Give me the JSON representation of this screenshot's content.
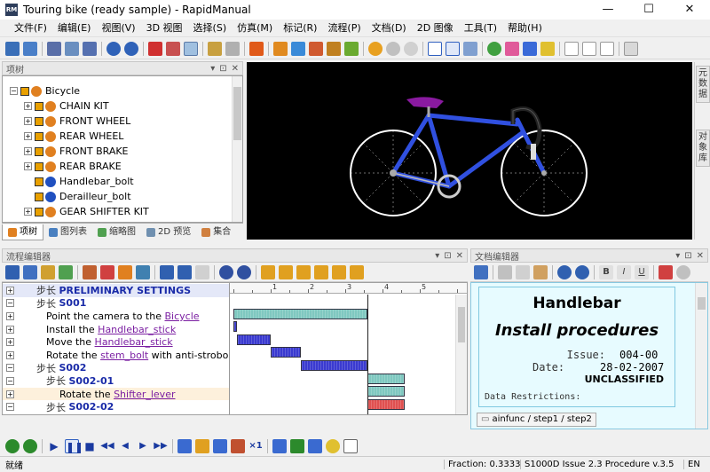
{
  "window": {
    "title": "Touring bike (ready sample) - RapidManual",
    "app_icon_text": "RM",
    "controls": [
      "—",
      "☐",
      "✕"
    ]
  },
  "menu": [
    "文件(F)",
    "编辑(E)",
    "视图(V)",
    "3D 视图",
    "选择(S)",
    "仿真(M)",
    "标记(R)",
    "流程(P)",
    "文档(D)",
    "2D 图像",
    "工具(T)",
    "帮助(H)"
  ],
  "project_panel": {
    "title": "项树",
    "tree": [
      {
        "label": "Bicycle",
        "level": 0,
        "expand": "−",
        "icon": "assembly"
      },
      {
        "label": "CHAIN KIT",
        "level": 1,
        "expand": "+",
        "icon": "assembly"
      },
      {
        "label": "FRONT WHEEL",
        "level": 1,
        "expand": "+",
        "icon": "assembly"
      },
      {
        "label": "REAR WHEEL",
        "level": 1,
        "expand": "+",
        "icon": "assembly"
      },
      {
        "label": "FRONT BRAKE",
        "level": 1,
        "expand": "+",
        "icon": "assembly"
      },
      {
        "label": "REAR BRAKE",
        "level": 1,
        "expand": "+",
        "icon": "assembly"
      },
      {
        "label": "Handlebar_bolt",
        "level": 1,
        "expand": "",
        "icon": "part"
      },
      {
        "label": "Derailleur_bolt",
        "level": 1,
        "expand": "",
        "icon": "part"
      },
      {
        "label": "GEAR SHIFTER KIT",
        "level": 1,
        "expand": "+",
        "icon": "assembly"
      }
    ],
    "tabs": [
      "项树",
      "图列表",
      "缩略图",
      "2D 预览",
      "集合"
    ]
  },
  "right_side_tabs": [
    "元数据",
    "对象库"
  ],
  "flow_panel": {
    "title": "流程编辑器",
    "rows": [
      {
        "exp": "+",
        "indent": 1,
        "prefix": "步长",
        "text": "PRELIMINARY SETTINGS",
        "kind": "step",
        "link": ""
      },
      {
        "exp": "−",
        "indent": 1,
        "prefix": "步长",
        "text": "S001",
        "kind": "step",
        "link": ""
      },
      {
        "exp": "+",
        "indent": 2,
        "prefix": "",
        "text": "Point the camera to the",
        "kind": "action",
        "link": "Bicycle"
      },
      {
        "exp": "+",
        "indent": 2,
        "prefix": "",
        "text": "Install the",
        "kind": "action",
        "link": "Handlebar_stick"
      },
      {
        "exp": "+",
        "indent": 2,
        "prefix": "",
        "text": "Move the",
        "kind": "action",
        "link": "Handlebar_stick"
      },
      {
        "exp": "+",
        "indent": 2,
        "prefix": "",
        "text": "Rotate the",
        "kind": "action",
        "link": "stem_bolt",
        "suffix": "with anti-stroboscc"
      },
      {
        "exp": "−",
        "indent": 1,
        "prefix": "步长",
        "text": "S002",
        "kind": "step",
        "link": ""
      },
      {
        "exp": "−",
        "indent": 2,
        "prefix": "步长",
        "text": "S002-01",
        "kind": "step",
        "link": ""
      },
      {
        "exp": "+",
        "indent": 3,
        "prefix": "",
        "text": "Rotate the",
        "kind": "action",
        "link": "Shifter_lever",
        "selected": true
      },
      {
        "exp": "−",
        "indent": 2,
        "prefix": "步长",
        "text": "S002-02",
        "kind": "step",
        "link": ""
      }
    ],
    "timeline_ticks": [
      "1",
      "2",
      "3",
      "4",
      "5"
    ],
    "gantt": [
      {
        "row": 1,
        "start": 0.0,
        "end": 3.6,
        "color": "#7fc8c0"
      },
      {
        "row": 2,
        "start": 0.0,
        "end": 0.1,
        "color": "#3a3ad0"
      },
      {
        "row": 3,
        "start": 0.1,
        "end": 1.0,
        "color": "#3a3ad0"
      },
      {
        "row": 4,
        "start": 1.0,
        "end": 1.8,
        "color": "#3a3ad0"
      },
      {
        "row": 5,
        "start": 1.8,
        "end": 3.6,
        "color": "#3a3ad0"
      },
      {
        "row": 6,
        "start": 3.6,
        "end": 4.6,
        "color": "#7fc8c0"
      },
      {
        "row": 7,
        "start": 3.6,
        "end": 4.6,
        "color": "#7fc8c0"
      },
      {
        "row": 8,
        "start": 3.6,
        "end": 4.6,
        "color": "#e05050"
      }
    ]
  },
  "doc_panel": {
    "title": "文档编辑器",
    "heading": "Handlebar",
    "subheading": "Install procedures",
    "issue_label": "Issue:",
    "issue_value": "004-00",
    "date_label": "Date:",
    "date_value": "28-02-2007",
    "classification": "UNCLASSIFIED",
    "restrictions": "Data Restrictions:",
    "breadcrumb": "ainfunc / step1 / step2"
  },
  "status": {
    "left": "就绪",
    "fraction": "Fraction: 0.3333",
    "issue": "S1000D Issue 2.3 Procedure v.3.5",
    "lang": "EN"
  },
  "colors": {
    "frame": "#3050e0",
    "seat": "#8a1aa0",
    "viewport": "#000000",
    "doc_bg": "#e7fbff"
  }
}
